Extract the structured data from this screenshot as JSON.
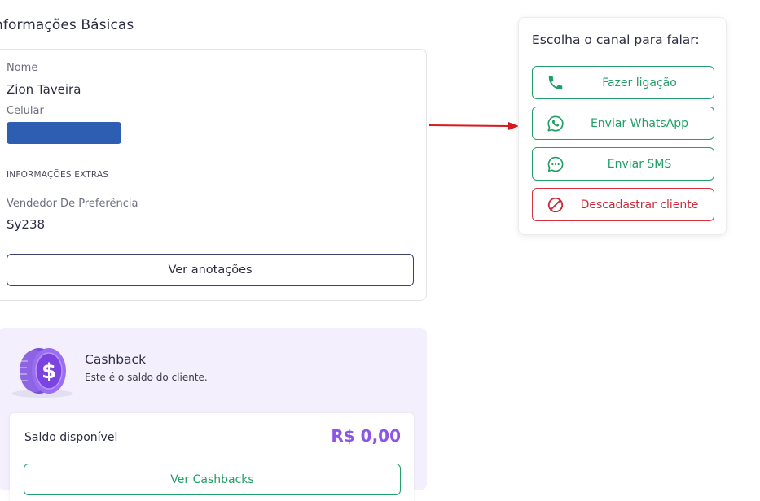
{
  "basic_info": {
    "title": "nformações Básicas",
    "name_label": "Nome",
    "name_value": "Zion Taveira",
    "phone_label": "Celular",
    "extras_title": "INFORMAÇÕES EXTRAS",
    "seller_label": "Vendedor De Preferência",
    "seller_value": "Sy238",
    "notes_button": "Ver anotações"
  },
  "channels": {
    "title": "Escolha o canal para falar:",
    "buttons": [
      {
        "label": "Fazer ligação",
        "icon": "phone-icon"
      },
      {
        "label": "Enviar WhatsApp",
        "icon": "whatsapp-icon"
      },
      {
        "label": "Enviar SMS",
        "icon": "sms-icon"
      },
      {
        "label": "Descadastrar cliente",
        "icon": "block-icon"
      }
    ]
  },
  "cashback": {
    "title": "Cashback",
    "subtitle": "Este é o saldo do cliente.",
    "balance_label": "Saldo disponível",
    "balance_value": "R$ 0,00",
    "button": "Ver Cashbacks"
  },
  "colors": {
    "green": "#22a06b",
    "red": "#d7303f",
    "purple": "#8b55e6",
    "phone_mask": "#2d5eb1",
    "panel_bg": "#f3effc"
  }
}
